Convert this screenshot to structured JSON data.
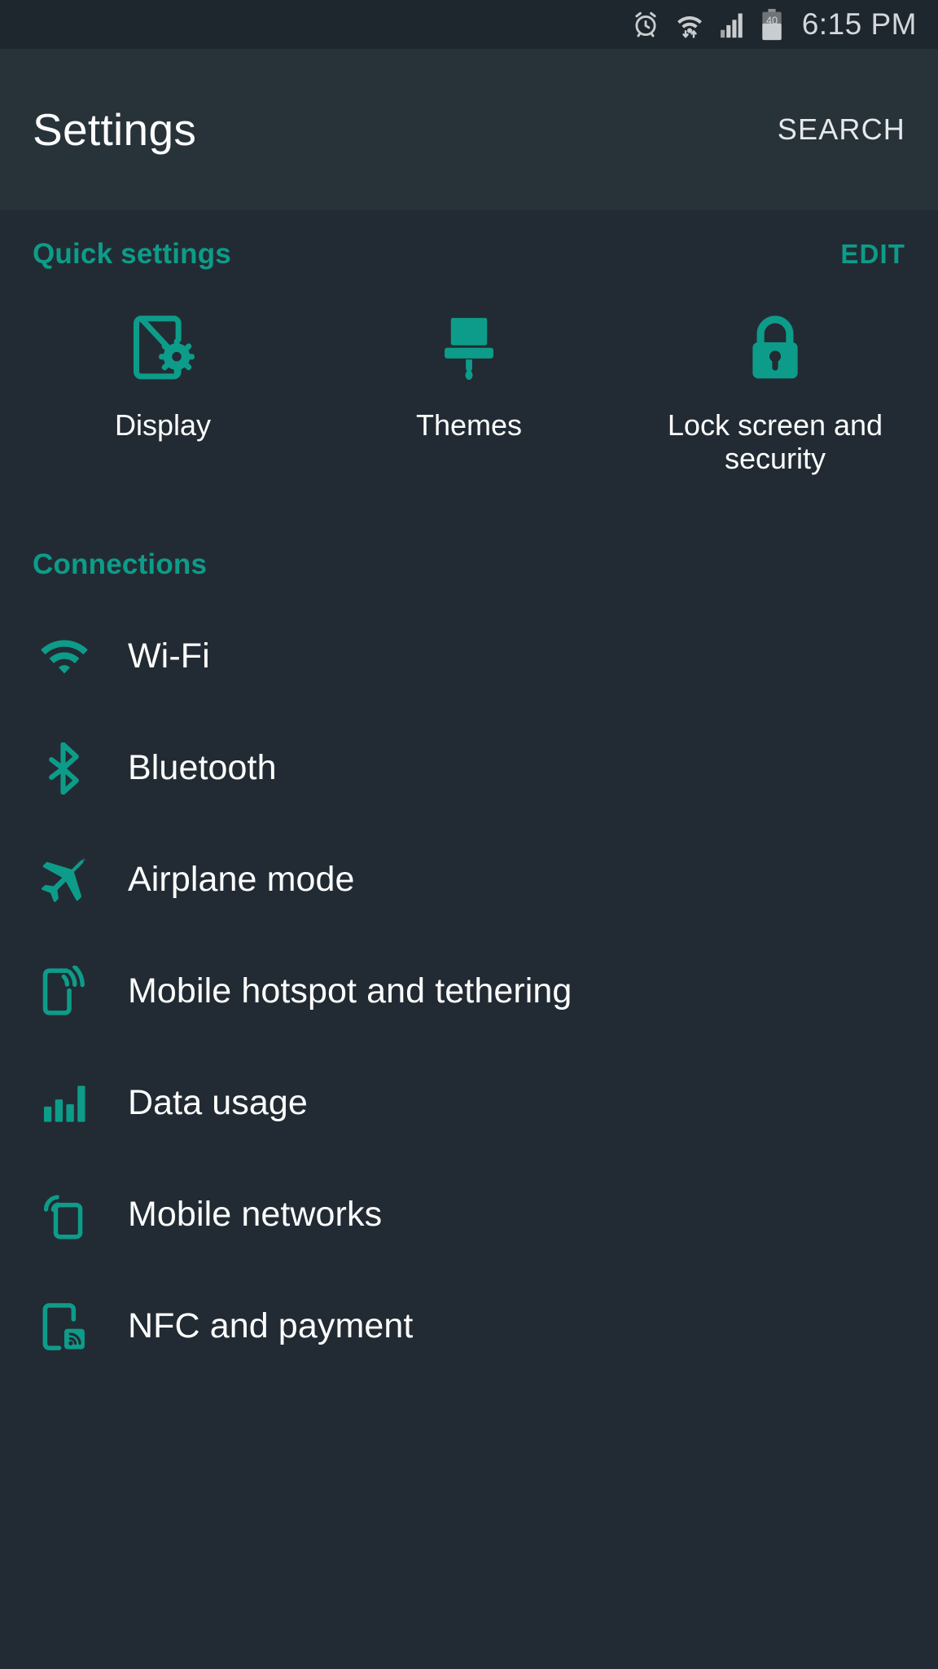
{
  "status_bar": {
    "background": "#1e262e",
    "time": "6:15 PM",
    "battery_level": "40",
    "icons": [
      "alarm-clock-icon",
      "wifi-data-icon",
      "cellular-signal-icon",
      "battery-icon"
    ]
  },
  "app_bar": {
    "background": "#283239",
    "title": "Settings",
    "search_label": "SEARCH"
  },
  "accent_color": "#0d9c89",
  "content_background": "#222b33",
  "quick_settings": {
    "title": "Quick settings",
    "edit_label": "EDIT",
    "tiles": [
      {
        "label": "Display",
        "icon": "display-icon"
      },
      {
        "label": "Themes",
        "icon": "themes-icon"
      },
      {
        "label": "Lock screen and security",
        "icon": "lock-icon"
      }
    ]
  },
  "connections": {
    "title": "Connections",
    "items": [
      {
        "label": "Wi-Fi",
        "icon": "wifi-icon"
      },
      {
        "label": "Bluetooth",
        "icon": "bluetooth-icon"
      },
      {
        "label": "Airplane mode",
        "icon": "airplane-icon"
      },
      {
        "label": "Mobile hotspot and tethering",
        "icon": "hotspot-icon"
      },
      {
        "label": "Data usage",
        "icon": "data-usage-icon"
      },
      {
        "label": "Mobile networks",
        "icon": "mobile-networks-icon"
      },
      {
        "label": "NFC and payment",
        "icon": "nfc-icon"
      }
    ]
  }
}
